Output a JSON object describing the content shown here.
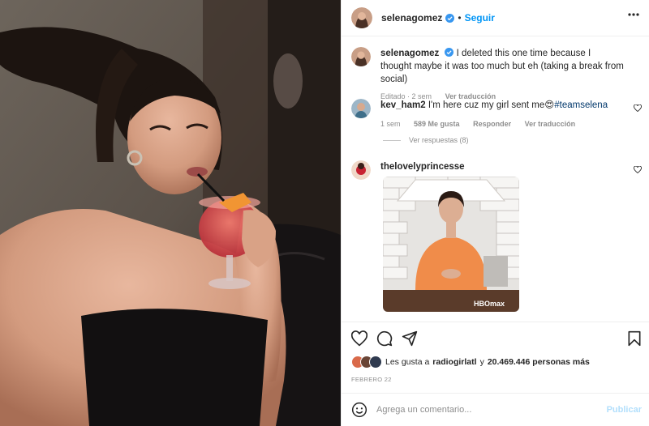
{
  "post": {
    "author": "selenagomez",
    "follow_label": "Seguir",
    "dot": "•",
    "caption": {
      "username": "selenagomez",
      "text": "I deleted this one time because I thought maybe it was too much but eh (taking a break from social)",
      "edited": "Editado",
      "time": "2 sem",
      "translate": "Ver traducción"
    },
    "comments": [
      {
        "username": "kev_ham2",
        "text": "I'm here cuz my girl sent me😍",
        "hashtag": "#teamselena",
        "time": "1 sem",
        "likes": "589 Me gusta",
        "reply": "Responder",
        "translate": "Ver traducción",
        "view_replies": "Ver respuestas (8)"
      },
      {
        "username": "thelovelyprincesse",
        "gif_label": "HBOmax"
      }
    ],
    "likes": {
      "prefix": "Les gusta a",
      "user": "radiogirlatl",
      "joiner": "y",
      "count": "20.469.446 personas más"
    },
    "date": "FEBRERO 22",
    "comment_box": {
      "placeholder": "Agrega un comentario...",
      "publish": "Publicar"
    }
  },
  "colors": {
    "link": "#0095f6",
    "verified": "#3897f0",
    "muted": "#8e8e8e",
    "publish_disabled": "#b2dffc"
  },
  "icons": [
    "verified-icon",
    "more-icon",
    "heart-icon",
    "comment-icon",
    "share-icon",
    "bookmark-icon",
    "emoji-icon"
  ]
}
